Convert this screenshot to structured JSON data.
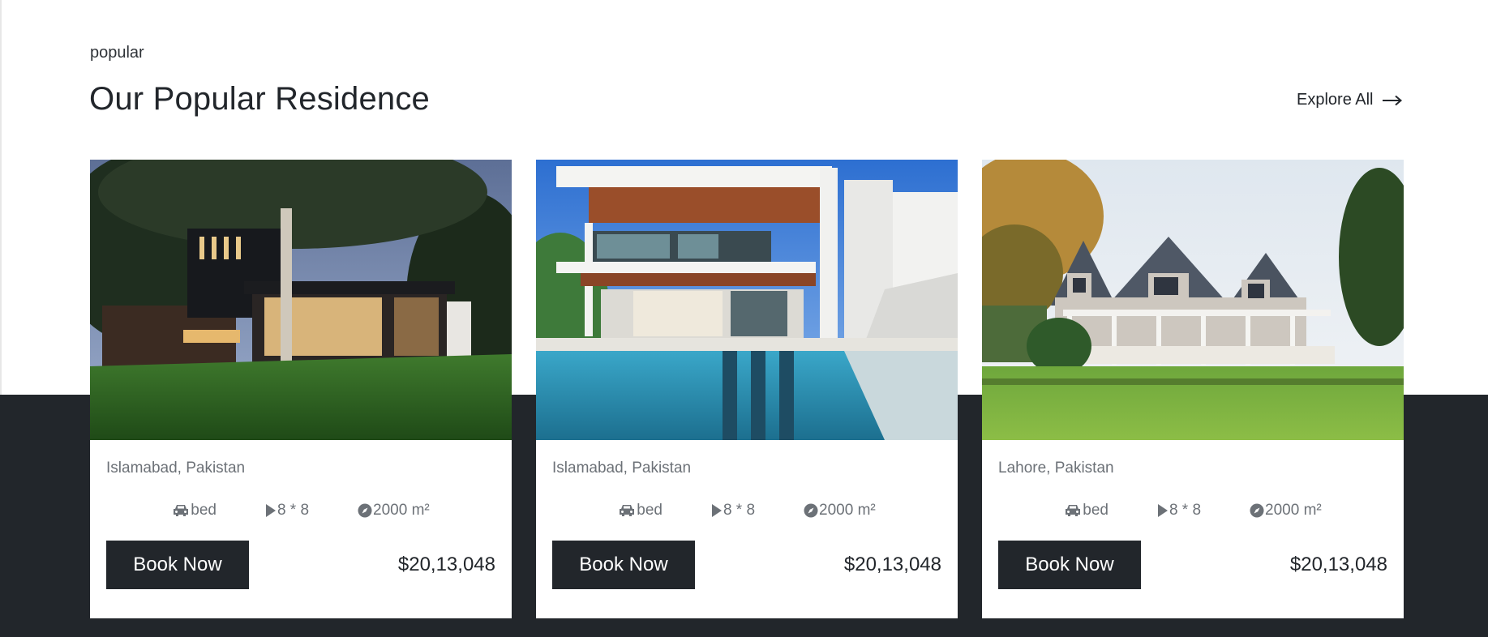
{
  "section": {
    "eyebrow": "popular",
    "title": "Our Popular Residence",
    "explore_label": "Explore All"
  },
  "cards": [
    {
      "location": "Islamabad, Pakistan",
      "features": {
        "beds": "bed",
        "size": "8 * 8",
        "area": "2000 m²"
      },
      "book_label": "Book Now",
      "price": "$20,13,048"
    },
    {
      "location": "Islamabad, Pakistan",
      "features": {
        "beds": "bed",
        "size": "8 * 8",
        "area": "2000 m²"
      },
      "book_label": "Book Now",
      "price": "$20,13,048"
    },
    {
      "location": "Lahore, Pakistan",
      "features": {
        "beds": "bed",
        "size": "8 * 8",
        "area": "2000 m²"
      },
      "book_label": "Book Now",
      "price": "$20,13,048"
    }
  ],
  "icons": {
    "beds": "car-icon",
    "size": "play-icon",
    "area": "compass-icon",
    "explore": "arrow-right-icon"
  },
  "colors": {
    "dark": "#22262b",
    "muted_text": "#6c7177",
    "background": "#ffffff"
  }
}
